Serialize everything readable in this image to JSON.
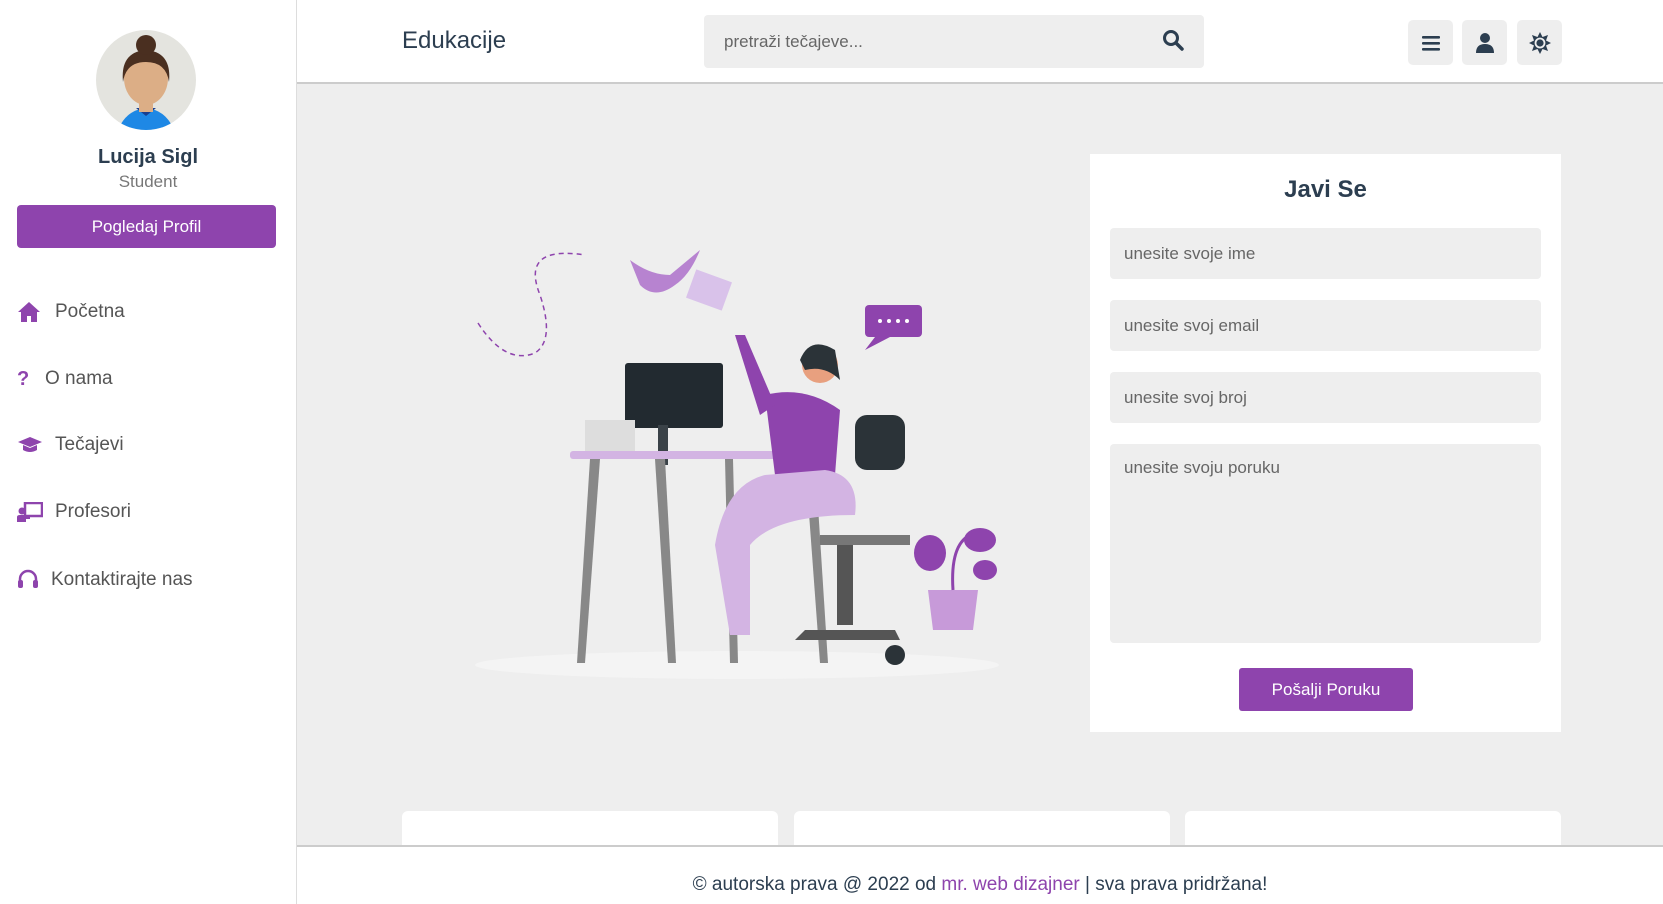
{
  "profile": {
    "name": "Lucija Sigl",
    "role": "Student",
    "button": "Pogledaj Profil"
  },
  "nav": [
    {
      "label": "Početna",
      "icon": "home-icon"
    },
    {
      "label": "O nama",
      "icon": "question-icon"
    },
    {
      "label": "Tečajevi",
      "icon": "graduation-cap-icon"
    },
    {
      "label": "Profesori",
      "icon": "chalkboard-teacher-icon"
    },
    {
      "label": "Kontaktirajte nas",
      "icon": "headset-icon"
    }
  ],
  "header": {
    "title": "Edukacije",
    "search_placeholder": "pretraži tečajeve..."
  },
  "contact": {
    "title": "Javi Se",
    "name_placeholder": "unesite svoje ime",
    "email_placeholder": "unesite svoj email",
    "phone_placeholder": "unesite svoj broj",
    "message_placeholder": "unesite svoju poruku",
    "submit": "Pošalji Poruku"
  },
  "footer": {
    "prefix": "© autorska prava @ 2022 od ",
    "link": "mr. web dizajner",
    "suffix": " | sva prava pridržana!"
  },
  "colors": {
    "accent": "#8e44ad",
    "dark": "#2c3e50",
    "bg": "#eeeeee"
  }
}
